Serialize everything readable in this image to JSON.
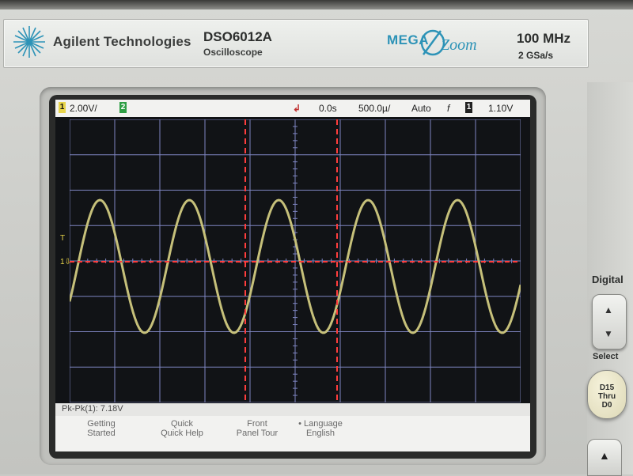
{
  "header": {
    "brand": "Agilent Technologies",
    "model": "DSO6012A",
    "model_subtitle": "Oscilloscope",
    "logo_mega": "MEGA",
    "logo_zoom": "Zoom",
    "bandwidth": "100 MHz",
    "sample_rate": "2 GSa/s"
  },
  "status": {
    "ch1_label": "1",
    "ch1_scale": "2.00V/",
    "ch2_label": "2",
    "trigger_position": "0.0s",
    "timebase": "500.0µ/",
    "trigger_mode": "Auto",
    "trigger_slope": "f",
    "trigger_channel": "1",
    "trigger_level": "1.10V"
  },
  "measurement": {
    "text": "Pk-Pk(1): 7.18V"
  },
  "softkeys": [
    {
      "line1": "Getting",
      "line2": "Started"
    },
    {
      "line1": "Quick",
      "line2": "Quick Help"
    },
    {
      "line1": "Front",
      "line2": "Panel Tour"
    },
    {
      "line1": "• Language",
      "line2": "English"
    }
  ],
  "side_panel": {
    "digital_label": "Digital",
    "select_label": "Select",
    "d15_line1": "D15",
    "d15_line2": "Thru",
    "d15_line3": "D0"
  },
  "colors": {
    "trace": "#c6c07a",
    "grid": "#7f86c2",
    "cursor": "#ff3d3d",
    "ch1_badge": "#e7d44a",
    "ch2_badge": "#2f9e45",
    "accent_blue": "#2d93b7"
  }
}
